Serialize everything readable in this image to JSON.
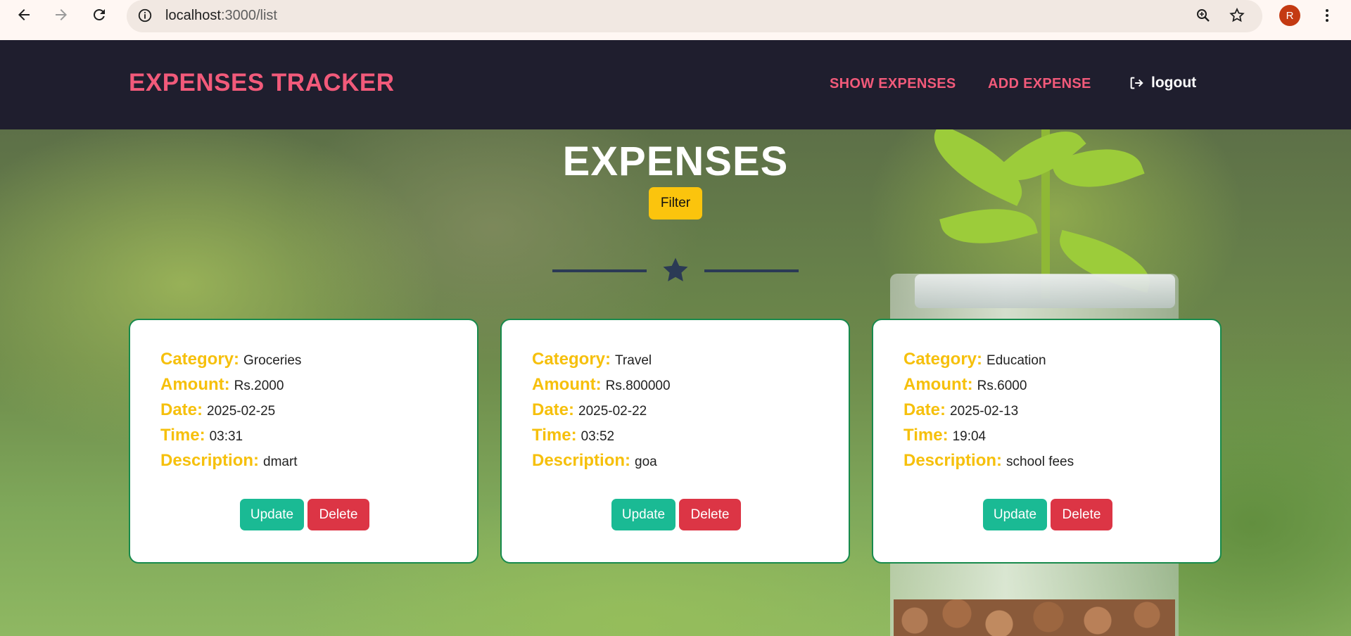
{
  "browser": {
    "url_host": "localhost",
    "url_path": ":3000/list",
    "profile_initial": "R"
  },
  "header": {
    "brand": "EXPENSES TRACKER",
    "nav": {
      "show_expenses": "SHOW EXPENSES",
      "add_expense": "ADD EXPENSE",
      "logout": "logout"
    }
  },
  "main": {
    "title": "EXPENSES",
    "filter_label": "Filter"
  },
  "labels": {
    "category": "Category:",
    "amount": "Amount:",
    "date": "Date:",
    "time": "Time:",
    "description": "Description:",
    "update": "Update",
    "delete": "Delete"
  },
  "expenses": [
    {
      "category": "Groceries",
      "amount": "Rs.2000",
      "date": "2025-02-25",
      "time": "03:31",
      "description": "dmart"
    },
    {
      "category": "Travel",
      "amount": "Rs.800000",
      "date": "2025-02-22",
      "time": "03:52",
      "description": "goa"
    },
    {
      "category": "Education",
      "amount": "Rs.6000",
      "date": "2025-02-13",
      "time": "19:04",
      "description": "school fees"
    }
  ],
  "colors": {
    "brand": "#f25a7a",
    "header_bg": "#1f1e2e",
    "label": "#f6c00c",
    "update": "#1aba94",
    "delete": "#dc3545",
    "filter": "#fbc40d"
  }
}
